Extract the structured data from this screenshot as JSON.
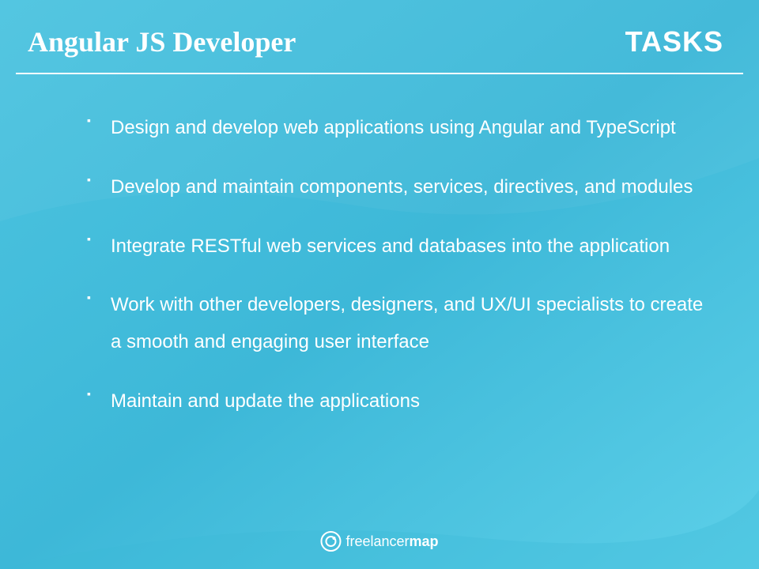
{
  "header": {
    "title": "Angular JS Developer",
    "section_label": "TASKS"
  },
  "tasks": [
    "Design and develop web applications using Angular and TypeScript",
    "Develop and maintain components, services, directives, and modules",
    "Integrate RESTful web services and databases into the application",
    "Work with other developers, designers, and UX/UI specialists to create a smooth and engaging user interface",
    "Maintain and update the applications"
  ],
  "logo": {
    "text_normal": "freelancer",
    "text_bold": "map"
  }
}
